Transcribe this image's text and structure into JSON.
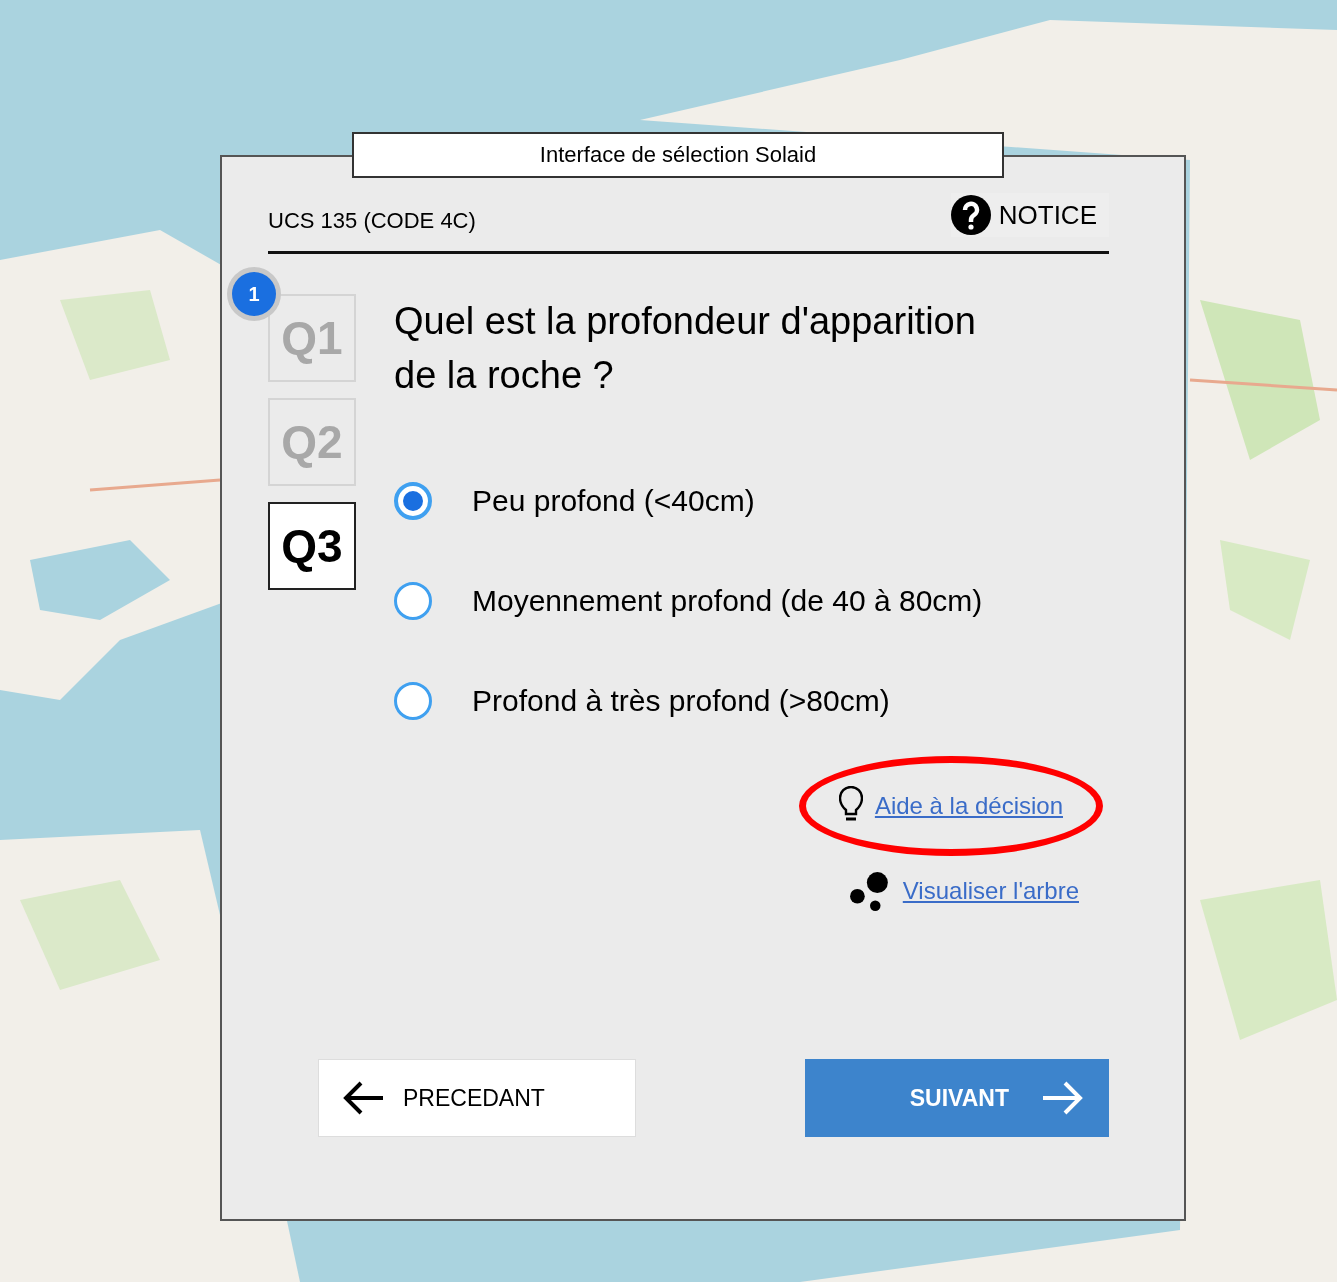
{
  "window": {
    "title": "Interface de sélection Solaid"
  },
  "header": {
    "unit": "UCS 135 (CODE 4C)",
    "notice": "NOTICE"
  },
  "steps": [
    {
      "label": "Q1",
      "selected": false,
      "badge": "1"
    },
    {
      "label": "Q2",
      "selected": false
    },
    {
      "label": "Q3",
      "selected": true
    }
  ],
  "question": "Quel est la profondeur d'apparition de la roche ?",
  "options": [
    {
      "label": "Peu profond (<40cm)",
      "selected": true
    },
    {
      "label": "Moyennement profond (de 40 à 80cm)",
      "selected": false
    },
    {
      "label": "Profond à très profond (>80cm)",
      "selected": false
    }
  ],
  "links": [
    {
      "kind": "help",
      "label": "Aide à la décision",
      "highlighted": true
    },
    {
      "kind": "tree",
      "label": "Visualiser l'arbre",
      "highlighted": false
    }
  ],
  "buttons": [
    {
      "kind": "previous",
      "label": "PRECEDANT"
    },
    {
      "kind": "next",
      "label": "SUIVANT"
    }
  ]
}
